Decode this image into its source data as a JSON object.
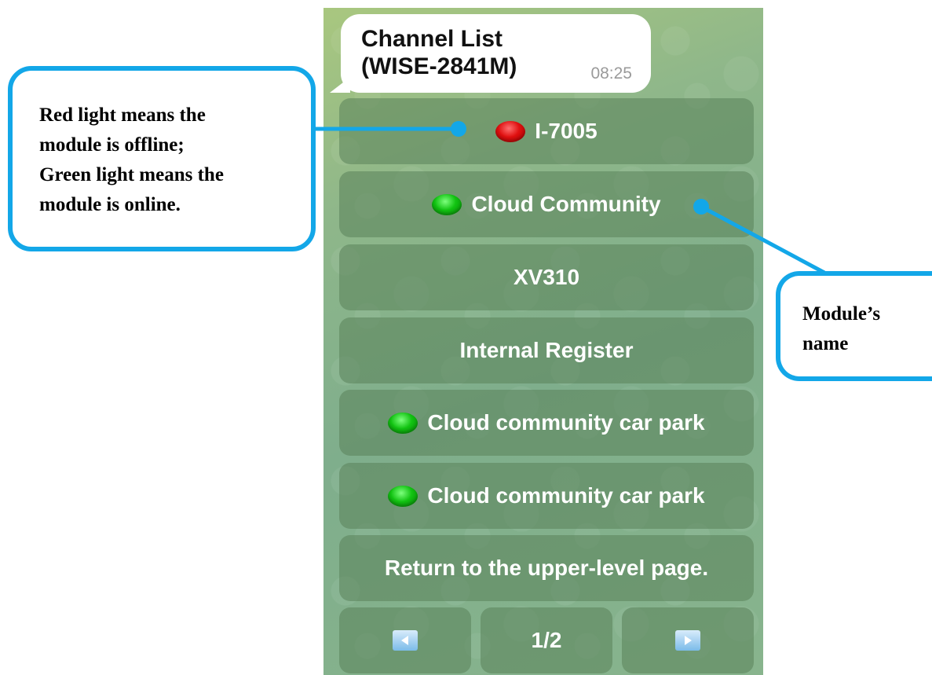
{
  "chat": {
    "title": "Channel List\n(WISE-2841M)",
    "time": "08:25"
  },
  "buttons": [
    {
      "label": "I-7005",
      "led": "red"
    },
    {
      "label": "Cloud Community",
      "led": "green"
    },
    {
      "label": "XV310",
      "led": "none"
    },
    {
      "label": "Internal Register",
      "led": "none"
    },
    {
      "label": "Cloud community car park",
      "led": "green"
    },
    {
      "label": "Cloud community car park",
      "led": "green"
    },
    {
      "label": "Return to the upper-level page.",
      "led": "none"
    }
  ],
  "pager": {
    "prev_icon": "left-arrow-icon",
    "page": "1/2",
    "next_icon": "right-arrow-icon"
  },
  "callouts": {
    "left": "Red light means the\nmodule is offline;\nGreen light means the\nmodule is online.",
    "right": "Module’s\nname"
  },
  "colors": {
    "callout_border": "#13a7e8",
    "led_red": "#e01010",
    "led_green": "#12c312",
    "button_bg": "#5a825a"
  }
}
